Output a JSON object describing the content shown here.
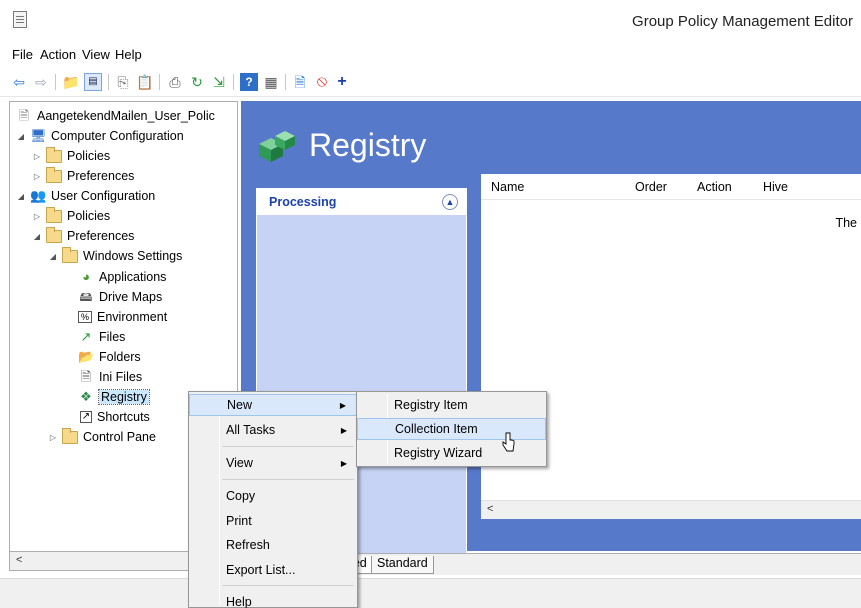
{
  "window": {
    "title": "Group Policy Management Editor"
  },
  "menubar": [
    "File",
    "Action",
    "View",
    "Help"
  ],
  "toolbar": {
    "icons": [
      "back-arrow-icon",
      "forward-arrow-icon",
      "up-folder-icon",
      "show-hide-tree-icon",
      "copy-icon",
      "paste-icon",
      "print-icon",
      "refresh-icon",
      "export-icon",
      "help-icon",
      "properties-icon",
      "new-item-icon",
      "stop-icon",
      "add-icon"
    ]
  },
  "tree": {
    "root": "AangetekendMailen_User_Polic",
    "computer_config": "Computer Configuration",
    "cc_policies": "Policies",
    "cc_preferences": "Preferences",
    "user_config": "User Configuration",
    "uc_policies": "Policies",
    "uc_preferences": "Preferences",
    "windows_settings": "Windows Settings",
    "applications": "Applications",
    "drive_maps": "Drive Maps",
    "environment": "Environment",
    "files": "Files",
    "folders": "Folders",
    "ini_files": "Ini Files",
    "registry": "Registry",
    "shortcuts": "Shortcuts",
    "control_panel": "Control Pane"
  },
  "main": {
    "heading": "Registry",
    "processing": "Processing",
    "columns": [
      "Name",
      "Order",
      "Action",
      "Hive"
    ],
    "empty_message": "The"
  },
  "tabs": {
    "extended": "ended",
    "standard": "Standard"
  },
  "context_menu": {
    "new": "New",
    "all_tasks": "All Tasks",
    "view": "View",
    "copy": "Copy",
    "print": "Print",
    "refresh": "Refresh",
    "export_list": "Export List...",
    "help": "Help"
  },
  "submenu": {
    "registry_item": "Registry Item",
    "collection_item": "Collection Item",
    "registry_wizard": "Registry Wizard"
  },
  "colors": {
    "accent_blue": "#5779ca",
    "panel_blue": "#c6d3f4",
    "highlight": "#d9e8fa"
  }
}
